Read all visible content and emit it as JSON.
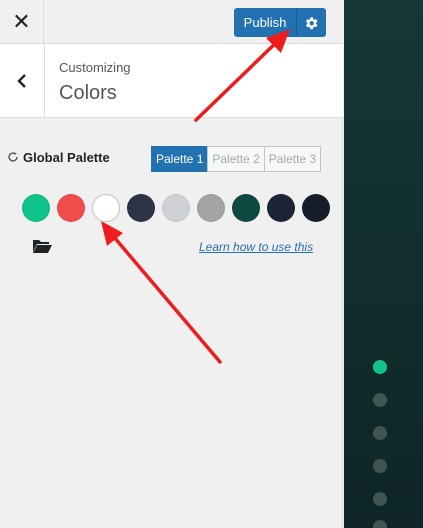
{
  "topbar": {
    "close_label": "✕",
    "publish_label": "Publish"
  },
  "section": {
    "breadcrumb": "Customizing",
    "title": "Colors"
  },
  "global_palette": {
    "label": "Global Palette",
    "tabs": [
      {
        "label": "Palette 1",
        "active": true
      },
      {
        "label": "Palette 2",
        "active": false
      },
      {
        "label": "Palette 3",
        "active": false
      }
    ],
    "swatches": [
      "#11c28c",
      "#f24d4d",
      "#ffffff",
      "#2d3446",
      "#cdd0d6",
      "#a3a3a3",
      "#0f4a42",
      "#1e2436",
      "#171c29"
    ],
    "learn_link": "Learn how to use this"
  },
  "preview": {
    "accent": "#13c28a"
  },
  "colors": {
    "primary": "#2271b1",
    "annotation_arrow": "#ee1c1c"
  }
}
